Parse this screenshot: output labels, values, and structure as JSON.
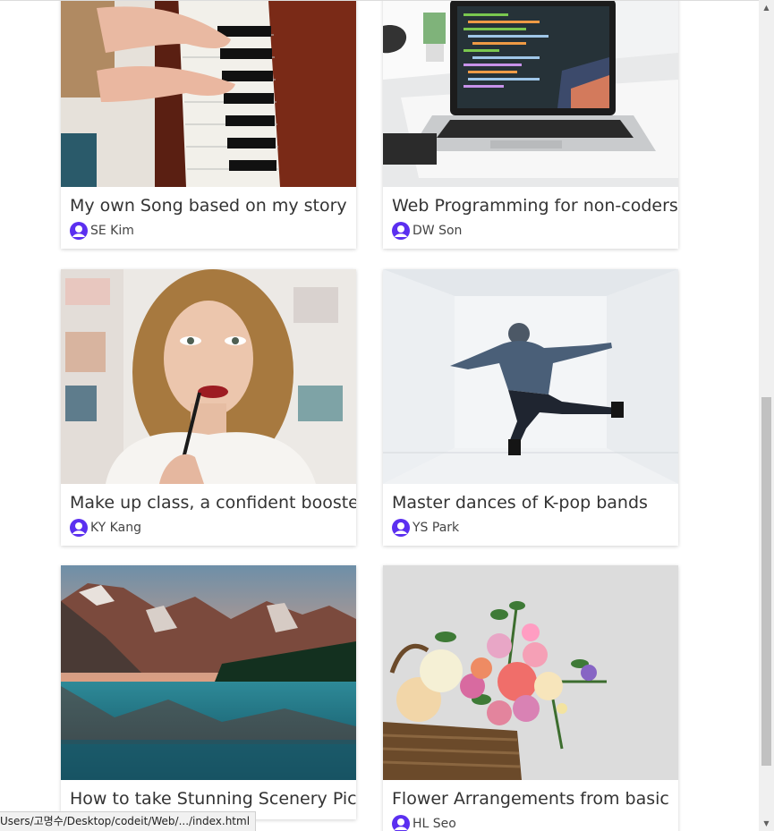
{
  "courses": [
    {
      "title": "My own Song based on my story",
      "author": "SE Kim",
      "image": "piano-photo"
    },
    {
      "title": "Web Programming for non-coders",
      "author": "DW Son",
      "image": "laptop-photo"
    },
    {
      "title": "Make up class, a confident booster",
      "author": "KY Kang",
      "image": "makeup-photo"
    },
    {
      "title": "Master dances of K-pop bands",
      "author": "YS Park",
      "image": "dancer-photo"
    },
    {
      "title": "How to take Stunning Scenery Pictures with your ...",
      "author": "",
      "image": "mountain-lake-photo"
    },
    {
      "title": "Flower Arrangements from basic",
      "author": "HL Seo",
      "image": "flower-basket-photo"
    }
  ],
  "status_bar": {
    "url": "Users/고명수/Desktop/codeit/Web/.../index.html"
  },
  "colors": {
    "avatar": "#5b2ff0",
    "title": "#333333"
  },
  "icons": {
    "avatar": "user-avatar-icon",
    "scroll_up": "scroll-up-arrow-icon",
    "scroll_down": "scroll-down-arrow-icon"
  }
}
